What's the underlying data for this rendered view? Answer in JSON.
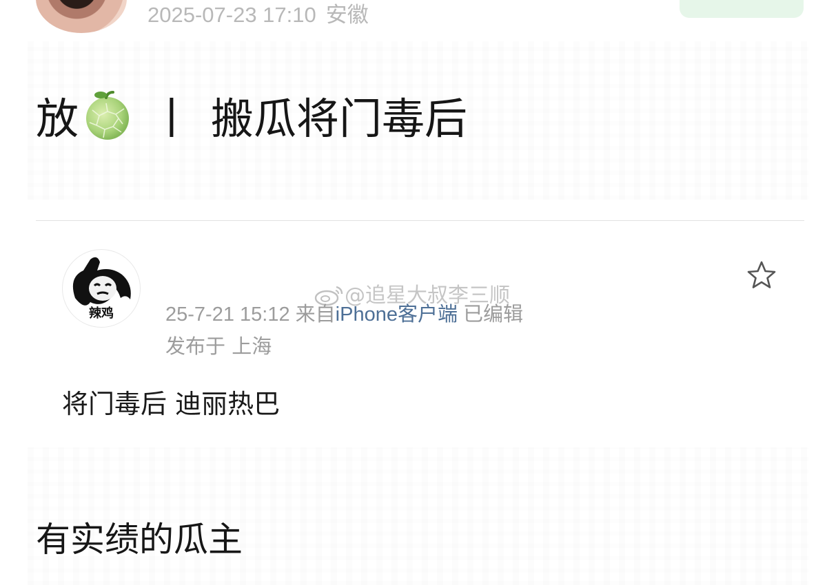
{
  "top_post": {
    "timestamp": "2025-07-23 17:10",
    "location": "安徽",
    "headline_prefix": "放",
    "headline_separator": "丨",
    "headline_text": "搬瓜将门毒后"
  },
  "quoted_post": {
    "avatar_caption": "辣鸡",
    "timestamp": "25-7-21 15:12",
    "from_label": "来自",
    "client": "iPhone客户端",
    "edited": "已编辑",
    "published_location": "发布于 上海",
    "body": "将门毒后 迪丽热巴"
  },
  "watermark": "@追星大叔李三顺",
  "section_title": "有实绩的瓜主",
  "colors": {
    "client_link": "#4d6f96",
    "meta_gray": "#9c9c9c",
    "follow_bg": "#e6f6e9"
  }
}
